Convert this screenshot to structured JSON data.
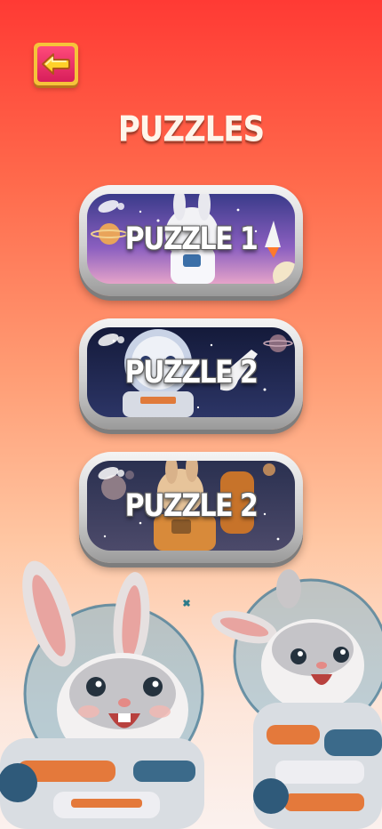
{
  "header": {
    "back_icon": "arrow-left-icon",
    "title": "PUZZLES"
  },
  "puzzles": [
    {
      "label": "PUZZLE 1"
    },
    {
      "label": "PUZZLE 2"
    },
    {
      "label": "PUZZLE 2"
    }
  ],
  "colors": {
    "background_top": "#ff3a34",
    "background_bottom": "#fbf1ee",
    "back_button": "#d81e5b",
    "back_button_border": "#f6c33a"
  }
}
